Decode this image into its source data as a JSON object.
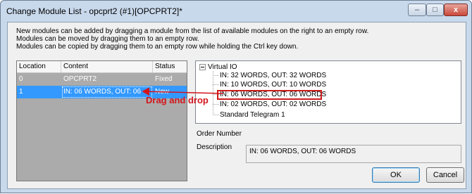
{
  "window": {
    "title": "Change Module List - opcprt2 (#1)[OPCPRT2]*",
    "controls": {
      "minimize": "–",
      "maximize": "□",
      "close": "x"
    }
  },
  "instructions": [
    "New modules can be added by dragging a module from the list of available modules on the right to an empty row.",
    "Modules can be moved by dragging them to an empty row.",
    "Modules can be copied by dragging them to an empty row while holding the Ctrl key down."
  ],
  "grid": {
    "headers": {
      "location": "Location",
      "content": "Content",
      "status": "Status"
    },
    "rows": [
      {
        "location": "0",
        "content": "OPCPRT2",
        "status": "Fixed"
      },
      {
        "location": "1",
        "content": "IN: 06 WORDS, OUT: 06",
        "status": "New"
      }
    ]
  },
  "tree": {
    "root": "Virtual IO",
    "items": [
      "IN: 32 WORDS, OUT: 32 WORDS",
      "IN: 10 WORDS, OUT: 10 WORDS",
      "IN: 06 WORDS, OUT: 06 WORDS",
      "IN: 02 WORDS, OUT: 02 WORDS",
      "Standard Telegram 1"
    ],
    "selected_index": 2
  },
  "details": {
    "order_number_label": "Order Number",
    "order_number_value": "",
    "description_label": "Description",
    "description_value": "IN: 06 WORDS, OUT: 06 WORDS"
  },
  "buttons": {
    "ok": "OK",
    "cancel": "Cancel"
  },
  "annotation": {
    "text": "Drag and drop",
    "color": "#d3161c"
  }
}
